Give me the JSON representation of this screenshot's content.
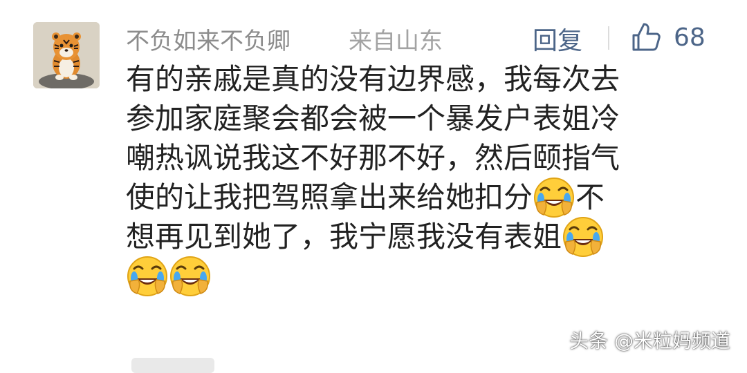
{
  "comment": {
    "username": "不负如来不负卿",
    "location": "来自山东",
    "reply_label": "回复",
    "like_count": "68",
    "lines": [
      {
        "text": "有的亲戚是真的没有边界感，我每次去",
        "emoji_after": 0
      },
      {
        "text": "参加家庭聚会都会被一个暴发户表姐冷",
        "emoji_after": 0
      },
      {
        "text": "嘲热讽说我这不好那不好，然后颐指气",
        "emoji_after": 0
      },
      {
        "text": "使的让我把驾照拿出来给她扣分",
        "emoji_after": 1,
        "text_after": "不"
      },
      {
        "text": "想再见到她了，我宁愿我没有表姐",
        "emoji_after": 1
      },
      {
        "text": "",
        "emoji_after": 2
      }
    ],
    "emoji_name": "crying-laughing-emoji"
  },
  "watermark": "头条 @米粒妈频道",
  "colors": {
    "username": "#8c8c8c",
    "location": "#a3a3a3",
    "action": "#4c6588",
    "text": "#222222"
  }
}
